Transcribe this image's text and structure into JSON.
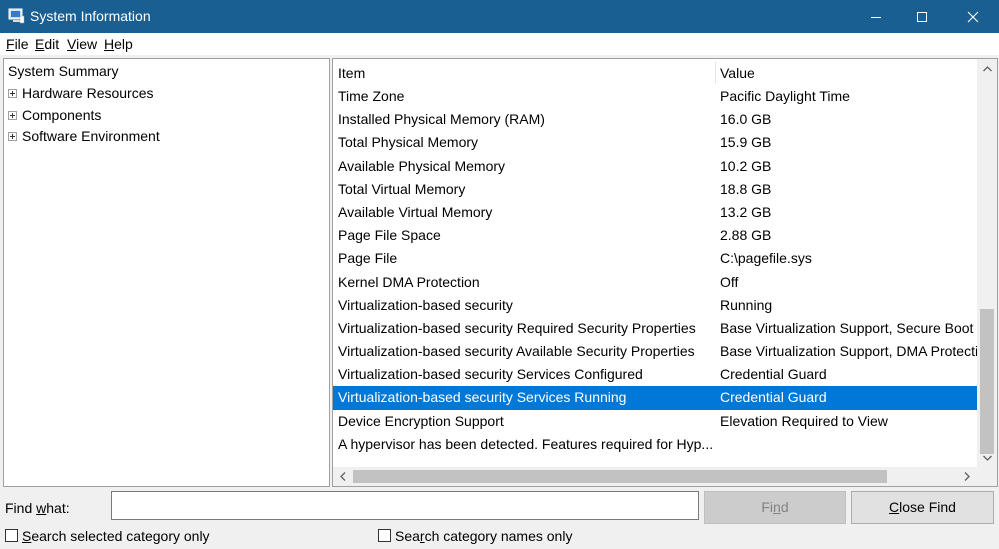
{
  "window": {
    "title": "System Information",
    "titlebar_color": "#1a5f91"
  },
  "menu": [
    {
      "mnemonic": "F",
      "rest": "ile"
    },
    {
      "mnemonic": "E",
      "rest": "dit"
    },
    {
      "mnemonic": "V",
      "rest": "iew"
    },
    {
      "mnemonic": "H",
      "rest": "elp"
    }
  ],
  "tree": {
    "root": "System Summary",
    "children": [
      "Hardware Resources",
      "Components",
      "Software Environment"
    ]
  },
  "list": {
    "headers": {
      "item": "Item",
      "value": "Value"
    },
    "rows": [
      {
        "item": "Time Zone",
        "value": "Pacific Daylight Time"
      },
      {
        "item": "Installed Physical Memory (RAM)",
        "value": "16.0 GB"
      },
      {
        "item": "Total Physical Memory",
        "value": "15.9 GB"
      },
      {
        "item": "Available Physical Memory",
        "value": "10.2 GB"
      },
      {
        "item": "Total Virtual Memory",
        "value": "18.8 GB"
      },
      {
        "item": "Available Virtual Memory",
        "value": "13.2 GB"
      },
      {
        "item": "Page File Space",
        "value": "2.88 GB"
      },
      {
        "item": "Page File",
        "value": "C:\\pagefile.sys"
      },
      {
        "item": "Kernel DMA Protection",
        "value": "Off"
      },
      {
        "item": "Virtualization-based security",
        "value": "Running"
      },
      {
        "item": "Virtualization-based security Required Security Properties",
        "value": "Base Virtualization Support, Secure Boot"
      },
      {
        "item": "Virtualization-based security Available Security Properties",
        "value": "Base Virtualization Support, DMA Protection"
      },
      {
        "item": "Virtualization-based security Services Configured",
        "value": "Credential Guard"
      },
      {
        "item": "Virtualization-based security Services Running",
        "value": "Credential Guard"
      },
      {
        "item": "Device Encryption Support",
        "value": "Elevation Required to View"
      },
      {
        "item": "A hypervisor has been detected. Features required for Hyp...",
        "value": ""
      }
    ],
    "selected_index": 13,
    "selection_color": "#0078d7"
  },
  "find": {
    "label_mnemonic": "",
    "label_pre": "Find ",
    "label_u": "w",
    "label_post": "hat:",
    "value": "",
    "find_button": {
      "pre": "Fi",
      "u": "n",
      "post": "d"
    },
    "close_button": {
      "pre": "",
      "u": "C",
      "post": "lose Find"
    },
    "options": [
      {
        "pre": "",
        "u": "S",
        "post": "earch selected category only"
      },
      {
        "pre": "Sea",
        "u": "r",
        "post": "ch category names only"
      }
    ]
  }
}
